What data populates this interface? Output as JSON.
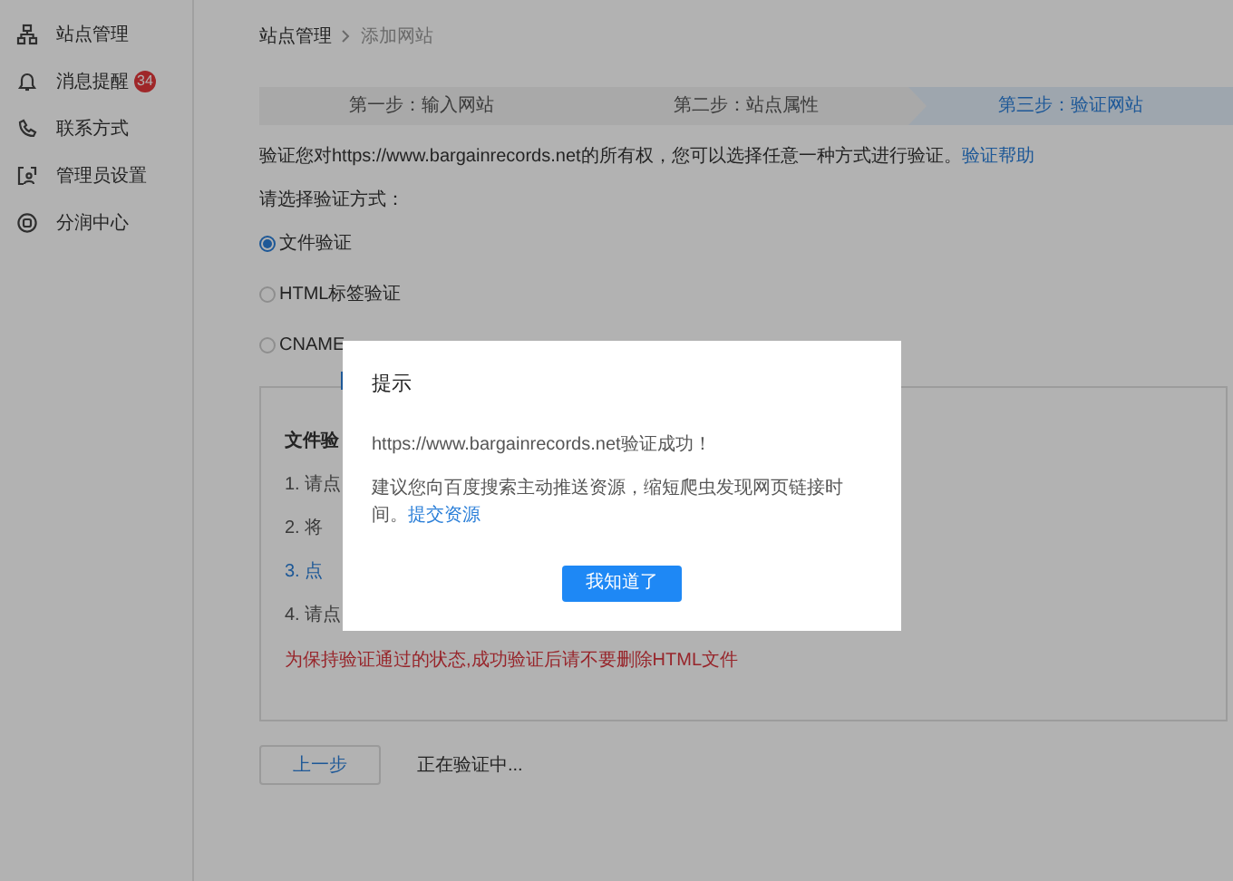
{
  "sidebar": {
    "items": [
      {
        "label": "站点管理"
      },
      {
        "label": "消息提醒",
        "badge": "34"
      },
      {
        "label": "联系方式"
      },
      {
        "label": "管理员设置"
      },
      {
        "label": "分润中心"
      }
    ]
  },
  "breadcrumb": [
    "站点管理",
    "添加网站"
  ],
  "steps": [
    {
      "label": "第一步：输入网站",
      "selected": false
    },
    {
      "label": "第二步：站点属性",
      "selected": false
    },
    {
      "label": "第三步：验证网站",
      "selected": true
    }
  ],
  "intro": {
    "text": "验证您对https://www.bargainrecords.net的所有权，您可以选择任意一种方式进行验证。",
    "link": "验证帮助"
  },
  "method_prompt": "请选择验证方式：",
  "methods": [
    {
      "label": "文件验证",
      "selected": true
    },
    {
      "label": "HTML标签验证",
      "selected": false
    },
    {
      "label": "CNAME",
      "selected": false
    }
  ],
  "panel": {
    "title": "文件验",
    "steps": [
      {
        "text": "1. 请点",
        "kind": "text"
      },
      {
        "text": "2. 将",
        "kind": "text"
      },
      {
        "text": "3. 点",
        "kind": "link"
      },
      {
        "text": "4. 请点",
        "kind": "text"
      }
    ],
    "warning": "为保持验证通过的状态,成功验证后请不要删除HTML文件"
  },
  "back_button": "上一步",
  "status": "正在验证中...",
  "dialog": {
    "title": "提示",
    "message": "https://www.bargainrecords.net验证成功！",
    "suggestion": "建议您向百度搜索主动推送资源，缩短爬虫发现网页链接时间。",
    "link": "提交资源",
    "button": "我知道了"
  }
}
